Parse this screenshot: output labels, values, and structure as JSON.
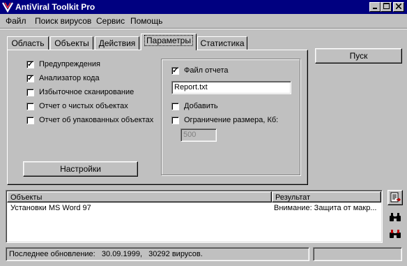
{
  "window": {
    "title": "AntiViral Toolkit Pro"
  },
  "menu": [
    "Файл",
    "Поиск вирусов",
    "Сервис",
    "Помощь"
  ],
  "tabs": [
    "Область",
    "Объекты",
    "Действия",
    "Параметры",
    "Статистика"
  ],
  "active_tab": "Параметры",
  "options": [
    {
      "label": "Предупреждения",
      "checked": true
    },
    {
      "label": "Анализатор кода",
      "checked": true
    },
    {
      "label": "Избыточное сканирование",
      "checked": false
    },
    {
      "label": "Отчет о чистых объектах",
      "checked": false
    },
    {
      "label": "Отчет об упакованных объектах",
      "checked": false
    }
  ],
  "settings_button": "Настройки",
  "report": {
    "file_label": "Файл отчета",
    "file_checked": true,
    "file_value": "Report.txt",
    "append_label": "Добавить",
    "append_checked": false,
    "limit_label": "Ограничение размера, Кб:",
    "limit_checked": false,
    "limit_value": "500"
  },
  "start_button": "Пуск",
  "results": {
    "col_objects": "Объекты",
    "col_result": "Результат",
    "rows": [
      {
        "object": "Установки MS Word 97",
        "result": "Внимание: Защита от макр..."
      }
    ]
  },
  "status": {
    "text": "Последнее обновление:   30.09.1999,   30292 вирусов."
  },
  "colors": {
    "title_bg": "#000080",
    "face": "#c0c0c0"
  },
  "icons": [
    "app-icon",
    "report-icon",
    "binoculars-icon",
    "binoculars-red-icon"
  ]
}
